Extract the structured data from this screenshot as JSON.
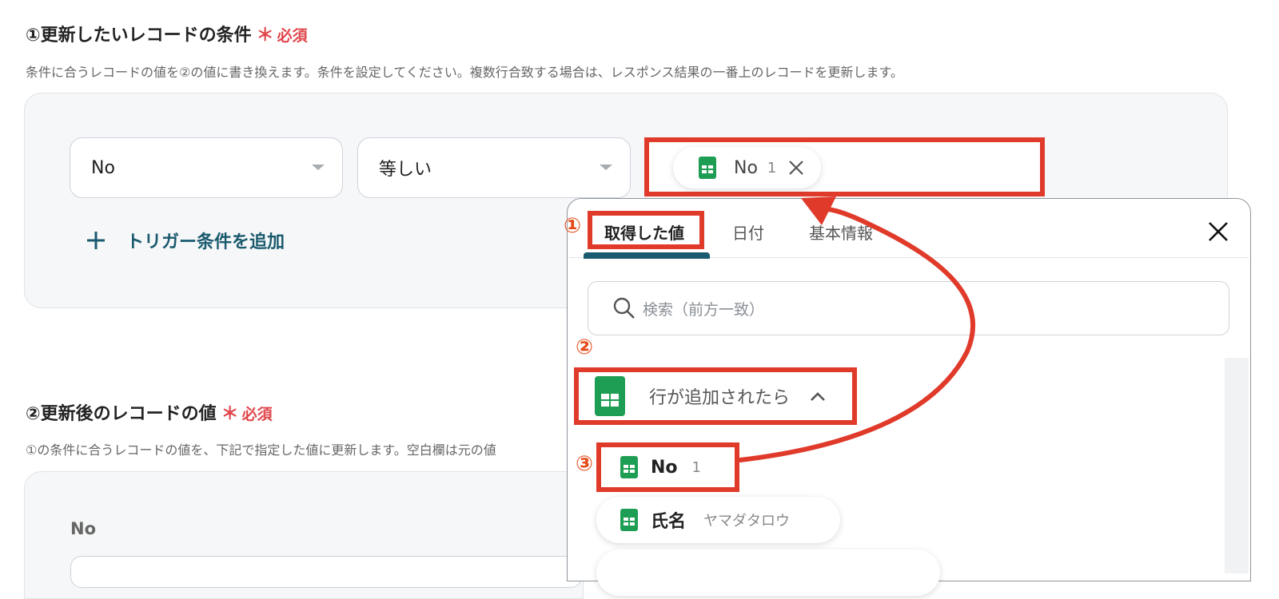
{
  "section1": {
    "title": "①更新したいレコードの条件",
    "required_mark": "＊",
    "required_label": "必須",
    "description": "条件に合うレコードの値を②の値に書き換えます。条件を設定してください。複数行合致する場合は、レスポンス結果の一番上のレコードを更新します。",
    "field_select": "No",
    "operator_select": "等しい",
    "value_chip": {
      "label": "No",
      "value": "1"
    },
    "add_condition": "トリガー条件を追加"
  },
  "section2": {
    "title": "②更新後のレコードの値",
    "required_mark": "＊",
    "required_label": "必須",
    "description": "①の条件に合うレコードの値を、下記で指定した値に更新します。空白欄は元の値",
    "field_label": "No"
  },
  "popup": {
    "tabs": [
      "取得した値",
      "日付",
      "基本情報"
    ],
    "search_placeholder": "検索（前方一致）",
    "group_label": "行が追加されたら",
    "items": [
      {
        "label": "No",
        "value": "1"
      },
      {
        "label": "氏名",
        "value": "ヤマダタロウ"
      }
    ]
  },
  "annotations": {
    "step1": "①",
    "step2": "②",
    "step3": "③"
  },
  "colors": {
    "accent": "#1a5a6e",
    "required": "#e0464b",
    "highlight": "#e03a2a",
    "sheets_green": "#1e9e54"
  }
}
